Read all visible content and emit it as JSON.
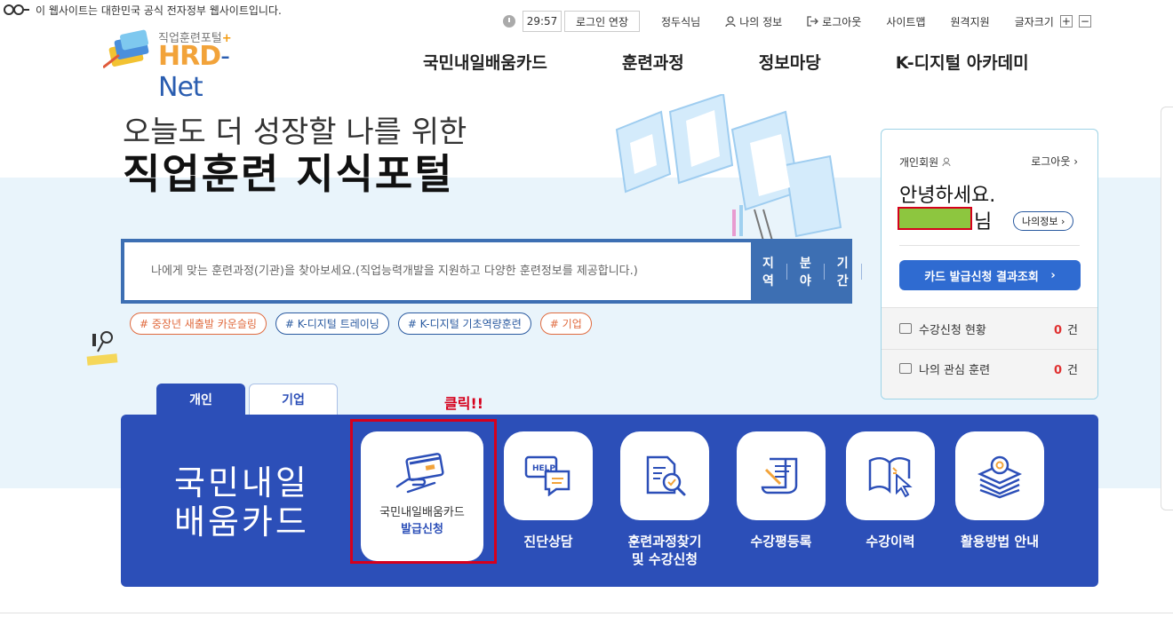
{
  "gov_notice": "이 웹사이트는 대한민국 공식 전자정부 웹사이트입니다.",
  "utility": {
    "timer": "29:57",
    "extend_login": "로그인 연장",
    "links": [
      "정두식님",
      "나의 정보",
      "로그아웃",
      "사이트맵",
      "원격지원",
      "글자크기"
    ],
    "plus": "+",
    "minus": "−"
  },
  "logo": {
    "sub": "직업훈련포털",
    "sub_plus": "+",
    "main_a": "HRD",
    "main_b": "- Net"
  },
  "gnb": [
    "국민내일배움카드",
    "훈련과정",
    "정보마당",
    "K-디지털 아카데미"
  ],
  "hero": {
    "line1": "오늘도 더 성장할 나를 위한",
    "line2": "직업훈련 지식포털"
  },
  "search": {
    "placeholder": "나에게 맞는 훈련과정(기관)을 찾아보세요.(직업능력개발을 지원하고 다양한 훈련정보를 제공합니다.)",
    "filters": [
      "지역",
      "분야",
      "기간"
    ]
  },
  "tags": [
    "# 중장년 새출발 카운슬링",
    "# K-디지털 트레이닝",
    "# K-디지털 기초역량훈련",
    "# 기업"
  ],
  "login": {
    "member_type": "개인회원",
    "logout": "로그아웃",
    "hello": "안녕하세요.",
    "nim": "님",
    "myinfo": "나의정보",
    "card_result": "카드 발급신청 결과조회",
    "rows": [
      {
        "label": "수강신청 현황",
        "count": "0",
        "unit": "건"
      },
      {
        "label": "나의 관심 훈련",
        "count": "0",
        "unit": "건"
      }
    ]
  },
  "tabs": [
    "개인",
    "기업"
  ],
  "click_note": "클릭!!",
  "panel": {
    "title_l1": "국민내일",
    "title_l2": "배움카드",
    "card_apply_l1": "국민내일배움카드",
    "card_apply_l2": "발급신청",
    "services": [
      "진단상담",
      "훈련과정찾기 및 수강신청",
      "수강평등록",
      "수강이력",
      "활용방법 안내"
    ]
  },
  "colors": {
    "primary": "#2c4fb8",
    "search": "#3d6fb3",
    "accent_red": "#d6001c",
    "hero_bg": "#e9f4fb"
  }
}
